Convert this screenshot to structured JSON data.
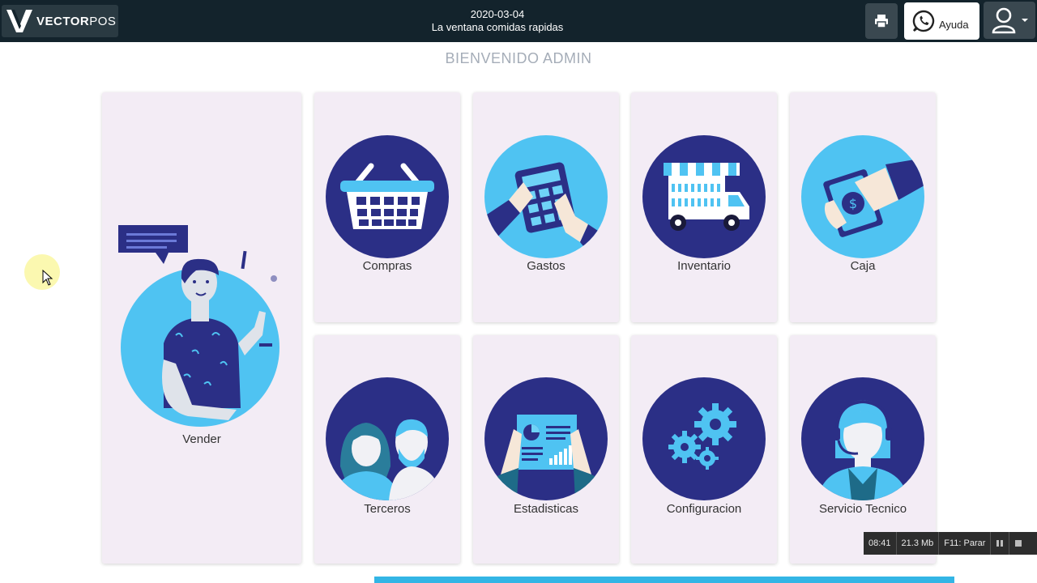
{
  "app": {
    "logo_text_bold": "VECTOR",
    "logo_text_light": "POS",
    "date": "2020-03-04",
    "business_name": "La ventana comidas rapidas"
  },
  "header": {
    "print_icon": "printer-icon",
    "help_icon": "whatsapp-icon",
    "help_label": "Ayuda",
    "user_icon": "user-icon"
  },
  "main": {
    "welcome": "BIENVENIDO ADMIN",
    "sell_label": "Vender",
    "tiles": [
      {
        "label": "Compras",
        "icon": "basket-icon"
      },
      {
        "label": "Gastos",
        "icon": "calculator-icon"
      },
      {
        "label": "Inventario",
        "icon": "truck-icon"
      },
      {
        "label": "Caja",
        "icon": "cash-icon"
      },
      {
        "label": "Terceros",
        "icon": "people-icon"
      },
      {
        "label": "Estadisticas",
        "icon": "report-icon"
      },
      {
        "label": "Configuracion",
        "icon": "gears-icon"
      },
      {
        "label": "Servicio Tecnico",
        "icon": "support-agent-icon"
      }
    ]
  },
  "recorder": {
    "time": "08:41",
    "size": "21.3 Mb",
    "stop_hint": "F11: Parar"
  },
  "colors": {
    "topbar": "#13232c",
    "navy": "#2b2f86",
    "sky": "#4fc3f2",
    "card": "#f3ecf5",
    "progress": "#33b5e5"
  }
}
